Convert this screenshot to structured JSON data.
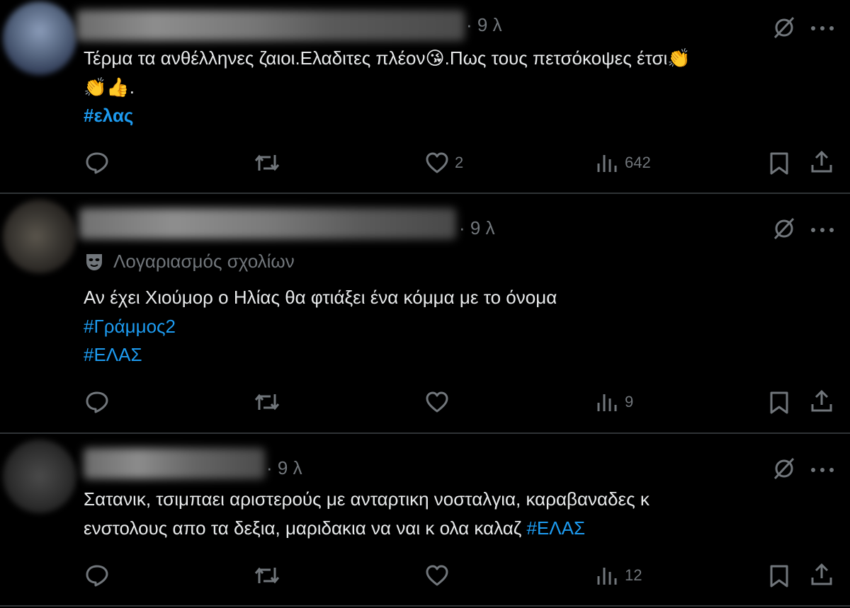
{
  "tweets": [
    {
      "time": "· 9 λ",
      "text_line1_a": "Τέρμα τα ανθέλληνες ζαιοι.Ελαδιτες πλέον",
      "emoji_kiss": "😘",
      "text_line1_b": ".Πως τους πετσόκοψες έτσι",
      "emoji_clap": "👏",
      "line2_emojis": "👏👍",
      "line2_dot": ".",
      "hashtag": "#ελας",
      "likes": "2",
      "views": "642"
    },
    {
      "time": "· 9 λ",
      "account_label": "Λογαριασμός σχολίων",
      "text_line1": "Αν έχει Χιούμορ ο Ηλίας θα φτιάξει ένα κόμμα με το όνομα",
      "hashtag1": "#Γράμμος2",
      "hashtag2": "#ΕΛΑΣ",
      "likes": "",
      "views": "9"
    },
    {
      "time": "· 9 λ",
      "text_line1": "Σατανικ, τσιμπαει αριστερούς με ανταρτικη νοσταλγια, καραβαναδες κ",
      "text_line2": "ενστολους απο τα δεξια, μαριδακια να ναι κ ολα καλαζ ",
      "hashtag": "#ΕΛΑΣ",
      "likes": "",
      "views": "12"
    }
  ],
  "icons": {
    "reply": "reply-icon",
    "retweet": "retweet-icon",
    "like": "heart-icon",
    "views": "views-icon",
    "bookmark": "bookmark-icon",
    "share": "share-icon",
    "grok": "grok-icon",
    "more": "more-icon",
    "mask": "mask-icon"
  },
  "colors": {
    "background": "#000000",
    "text": "#e7e9ea",
    "muted": "#71767b",
    "accent": "#1d9bf0",
    "divider": "#2f3336"
  }
}
